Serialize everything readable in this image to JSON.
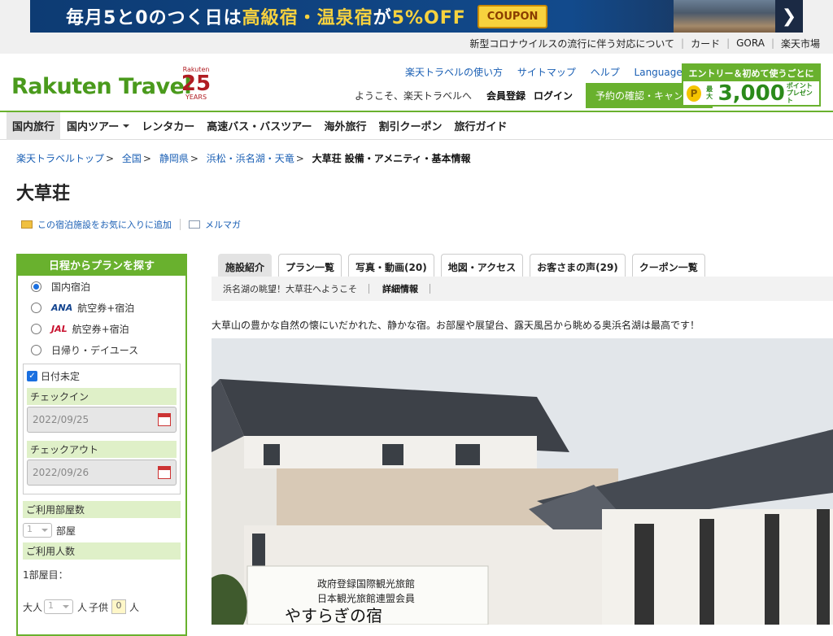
{
  "banner": {
    "text_prefix": "毎月5と0のつく日は",
    "text_yellow": "高級宿・温泉宿",
    "text_mid": "が",
    "text_pct": "5%OFF",
    "coupon_label": "COUPON",
    "arrow": "❯"
  },
  "utility": [
    "新型コロナウイルスの流行に伴う対応について",
    "カード",
    "GORA",
    "楽天市場"
  ],
  "header": {
    "logo": "Rakuten Travel",
    "anniv_top": "Rakuten",
    "anniv_num": "25",
    "anniv_bottom": "YEARS",
    "nav": [
      "楽天トラベルの使い方",
      "サイトマップ",
      "ヘルプ"
    ],
    "languages": "Languages",
    "welcome": "ようこそ、楽天トラベルへ",
    "register": "会員登録",
    "login": "ログイン",
    "confirm_button": "予約の確認・キャンセル",
    "promo_top": "エントリー＆初めて使うごとに",
    "promo_coin": "P",
    "promo_amount": "3,000",
    "promo_prefix": "最大",
    "promo_suffix": "ポイント",
    "promo_suffix2": "プレゼント"
  },
  "gnav": [
    "国内旅行",
    "国内ツアー",
    "レンタカー",
    "高速バス・バスツアー",
    "海外旅行",
    "割引クーポン",
    "旅行ガイド"
  ],
  "breadcrumb": [
    "楽天トラベルトップ",
    "全国",
    "静岡県",
    "浜松・浜名湖・天竜"
  ],
  "breadcrumb_current": "大草荘 設備・アメニティ・基本情報",
  "breadcrumb_sep": ">",
  "title": "大草荘",
  "actions": {
    "favorite": "この宿泊施設をお気に入りに追加",
    "mailmag": "メルマガ"
  },
  "sidebar": {
    "heading": "日程からプランを探す",
    "options": [
      "国内宿泊",
      "航空券+宿泊",
      "航空券+宿泊",
      "日帰り・デイユース"
    ],
    "ana": "ANA",
    "jal": "JAL",
    "date_undecided": "日付未定",
    "checkin_label": "チェックイン",
    "checkin_value": "2022/09/25",
    "checkout_label": "チェックアウト",
    "checkout_value": "2022/09/26",
    "rooms_label": "ご利用部屋数",
    "rooms_value": "1",
    "rooms_unit": "部屋",
    "guests_label": "ご利用人数",
    "room1": "1部屋目：",
    "adult": "大人",
    "adult_value": "1",
    "person": "人",
    "child": "子供",
    "child_value": "0",
    "person2": "人"
  },
  "tabs": [
    "施設紹介",
    "プラン一覧",
    "写真・動画(20)",
    "地図・アクセス",
    "お客さまの声(29)",
    "クーポン一覧"
  ],
  "subtabs": {
    "welcome": "浜名湖の眺望！大草荘へようこそ",
    "detail": "詳細情報"
  },
  "description": "大草山の豊かな自然の懐にいだかれた、静かな宿。お部屋や展望台、露天風呂から眺める奥浜名湖は最高です！",
  "sign": {
    "line1": "政府登録国際観光旅館",
    "line2": "日本観光旅館連盟会員",
    "line3": "やすらぎの宿"
  },
  "colors": {
    "brand_green": "#69b12e",
    "link_blue": "#1a5fb4"
  }
}
